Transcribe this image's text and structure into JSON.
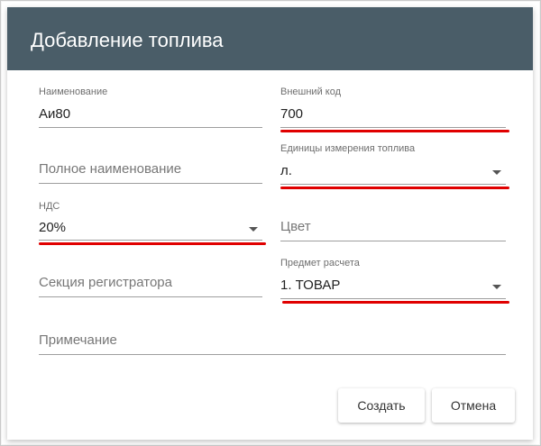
{
  "dialog": {
    "title": "Добавление топлива"
  },
  "fields": {
    "name": {
      "label": "Наименование",
      "value": "Аи80"
    },
    "external_code": {
      "label": "Внешний код",
      "value": "700"
    },
    "full_name": {
      "placeholder": "Полное наименование"
    },
    "units": {
      "label": "Единицы измерения топлива",
      "value": "л."
    },
    "vat": {
      "label": "НДС",
      "value": "20%"
    },
    "color": {
      "placeholder": "Цвет"
    },
    "register_section": {
      "placeholder": "Секция регистратора"
    },
    "payment_subject": {
      "label": "Предмет расчета",
      "value": "1. ТОВАР"
    },
    "note": {
      "placeholder": "Примечание"
    }
  },
  "buttons": {
    "create": "Создать",
    "cancel": "Отмена"
  },
  "icons": {
    "dropdown": "chevron-down-icon"
  },
  "colors": {
    "header_bg": "#4a5d68",
    "annotation": "#e00000"
  }
}
